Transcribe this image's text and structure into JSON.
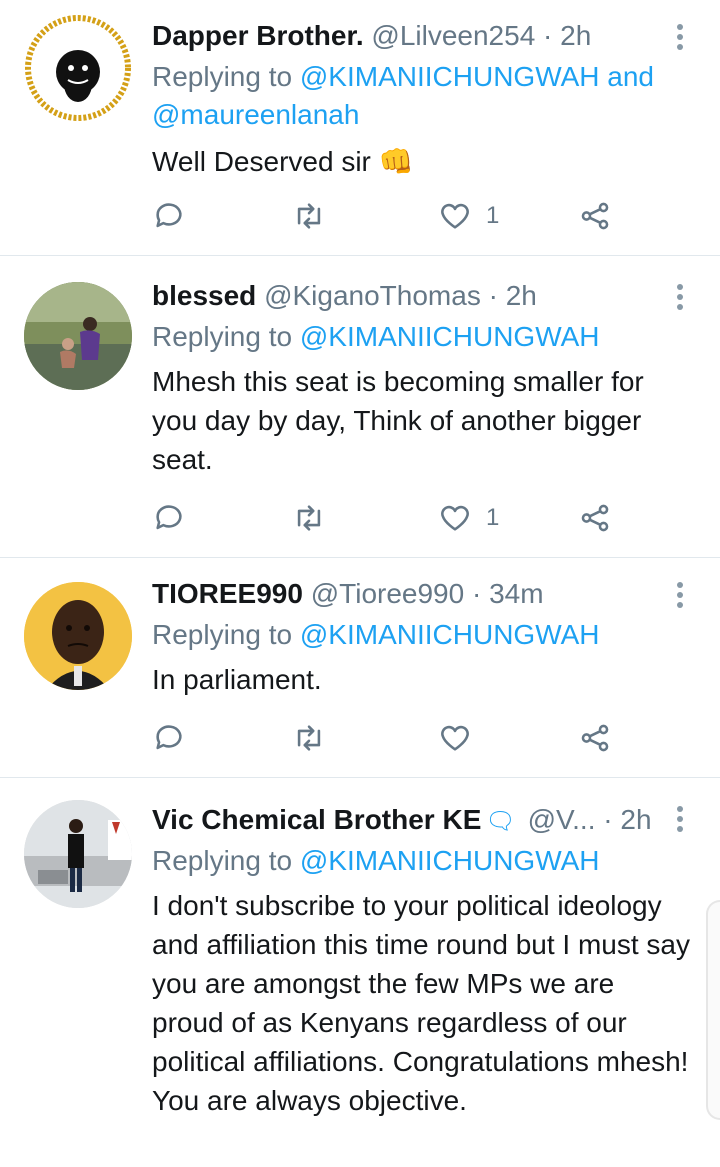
{
  "tweets": [
    {
      "name": "Dapper Brother.",
      "handle": "@Lilveen254",
      "time": "· 2h",
      "replying_prefix": "Replying to",
      "replying_mentions": "@KIMANIICHUNGWAH and @maureenlanah",
      "text": "Well Deserved sir 👊",
      "likes": "1",
      "avatar_text": "AFRICAN BOY"
    },
    {
      "name": "blessed",
      "handle": "@KiganoThomas",
      "time": "· 2h",
      "replying_prefix": "Replying to",
      "replying_mentions": "@KIMANIICHUNGWAH",
      "text": "Mhesh this seat is becoming smaller for you day by day, Think of another bigger seat.",
      "likes": "1"
    },
    {
      "name": "TIOREE990",
      "handle": "@Tioree990",
      "time": "· 34m",
      "replying_prefix": "Replying to",
      "replying_mentions": "@KIMANIICHUNGWAH",
      "text": "In parliament.",
      "likes": ""
    },
    {
      "name": "Vic Chemical Brother KE",
      "name_emoji": "🗨",
      "handle": "@V...",
      "time": "· 2h",
      "replying_prefix": "Replying to",
      "replying_mentions": "@KIMANIICHUNGWAH",
      "text": "I don't subscribe to your political ideology and  affiliation this time round but I must say you are amongst the few MPs we are proud of as Kenyans regardless of our political affiliations. Congratulations mhesh!  You are always objective.",
      "likes": ""
    }
  ],
  "icons": {
    "reply": "reply-icon",
    "retweet": "retweet-icon",
    "like": "heart-icon",
    "share": "share-icon",
    "more": "more-vertical-icon"
  },
  "colors": {
    "link": "#1da1f2",
    "muted": "#657786",
    "text": "#14171a",
    "icon": "#657786"
  }
}
